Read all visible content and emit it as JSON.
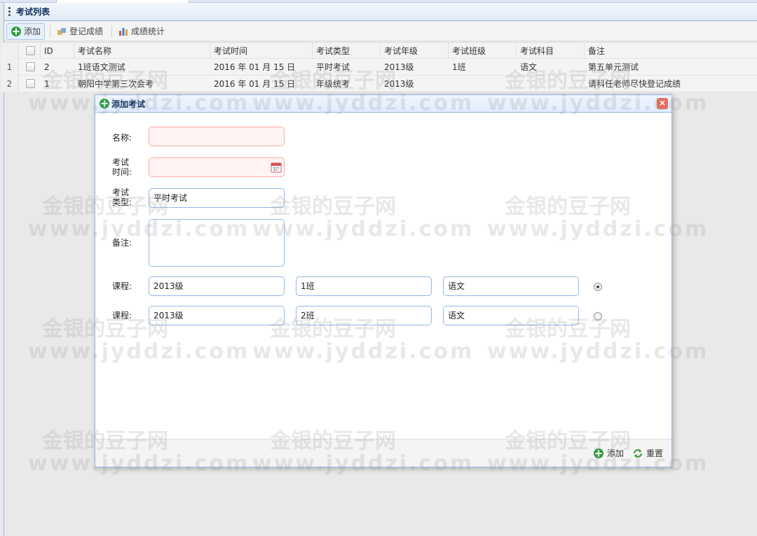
{
  "panel": {
    "title": "考试列表"
  },
  "toolbar": {
    "add_label": "添加",
    "register_label": "登记成绩",
    "stats_label": "成绩统计"
  },
  "table": {
    "columns": [
      "ID",
      "考试名称",
      "考试时间",
      "考试类型",
      "考试年级",
      "考试班级",
      "考试科目",
      "备注"
    ],
    "rows": [
      {
        "num": "1",
        "id": "2",
        "name": "1班语文测试",
        "time": "2016 年 01 月 15 日",
        "type": "平时考试",
        "grade": "2013级",
        "class": "1班",
        "subject": "语文",
        "note": "第五单元测试"
      },
      {
        "num": "2",
        "id": "1",
        "name": "朝阳中学第三次会考",
        "time": "2016 年 01 月 15 日",
        "type": "年级统考",
        "grade": "2013级",
        "class": "",
        "subject": "",
        "note": "请科任老师尽快登记成绩"
      }
    ]
  },
  "dialog": {
    "title": "添加考试",
    "name_label": "名称:",
    "time_label_1": "考试",
    "time_label_2": "时间:",
    "type_label_1": "考试",
    "type_label_2": "类型:",
    "type_value": "平时考试",
    "note_label": "备注:",
    "course_label": "课程:",
    "courses": [
      {
        "grade": "2013级",
        "class": "1班",
        "subject": "语文",
        "selected": true
      },
      {
        "grade": "2013级",
        "class": "2班",
        "subject": "语文",
        "selected": false
      }
    ],
    "add_button": "添加",
    "reset_button": "重置"
  },
  "watermark": {
    "line1": "金银的豆子网",
    "line2": "www.jyddzi.com"
  },
  "colors": {
    "accent": "#95b8e7",
    "title_text": "#0e2d5f",
    "invalid_bg": "#fff3f3",
    "add_icon": "#2e9e3e"
  }
}
